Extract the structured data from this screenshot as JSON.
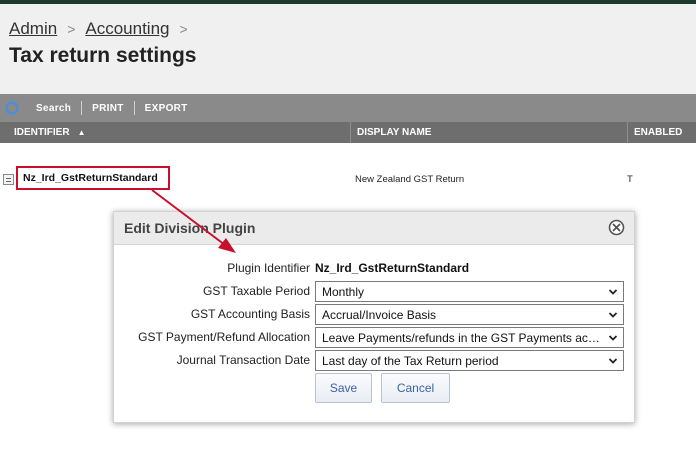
{
  "breadcrumb": {
    "items": [
      "Admin",
      "Accounting"
    ],
    "separator": ">"
  },
  "page": {
    "title": "Tax return settings"
  },
  "toolbar": {
    "search_label": "Search",
    "print_label": "PRINT",
    "export_label": "EXPORT",
    "refresh_icon": "refresh-icon"
  },
  "grid": {
    "columns": [
      "IDENTIFIER",
      "DISPLAY NAME",
      "ENABLED"
    ],
    "sort_indicator": "▲",
    "rows": [
      {
        "identifier": "Nz_Ird_GstReturnStandard",
        "display_name": "New Zealand GST Return",
        "enabled": "T"
      }
    ]
  },
  "modal": {
    "title": "Edit Division Plugin",
    "fields": {
      "plugin_identifier": {
        "label": "Plugin Identifier",
        "value": "Nz_Ird_GstReturnStandard"
      },
      "gst_taxable_period": {
        "label": "GST Taxable Period",
        "value": "Monthly"
      },
      "gst_accounting_basis": {
        "label": "GST Accounting Basis",
        "value": "Accrual/Invoice Basis"
      },
      "gst_payment_refund_allocation": {
        "label": "GST Payment/Refund Allocation",
        "value": "Leave Payments/refunds in the GST Payments account"
      },
      "journal_transaction_date": {
        "label": "Journal Transaction Date",
        "value": "Last day of the Tax Return period"
      }
    },
    "save_label": "Save",
    "cancel_label": "Cancel"
  },
  "colors": {
    "highlight": "#c8102e",
    "toolbar": "#8a8a8a",
    "header": "#6e6e6e",
    "button_text": "#3b63a3",
    "top_strip": "#1d3b2a"
  }
}
